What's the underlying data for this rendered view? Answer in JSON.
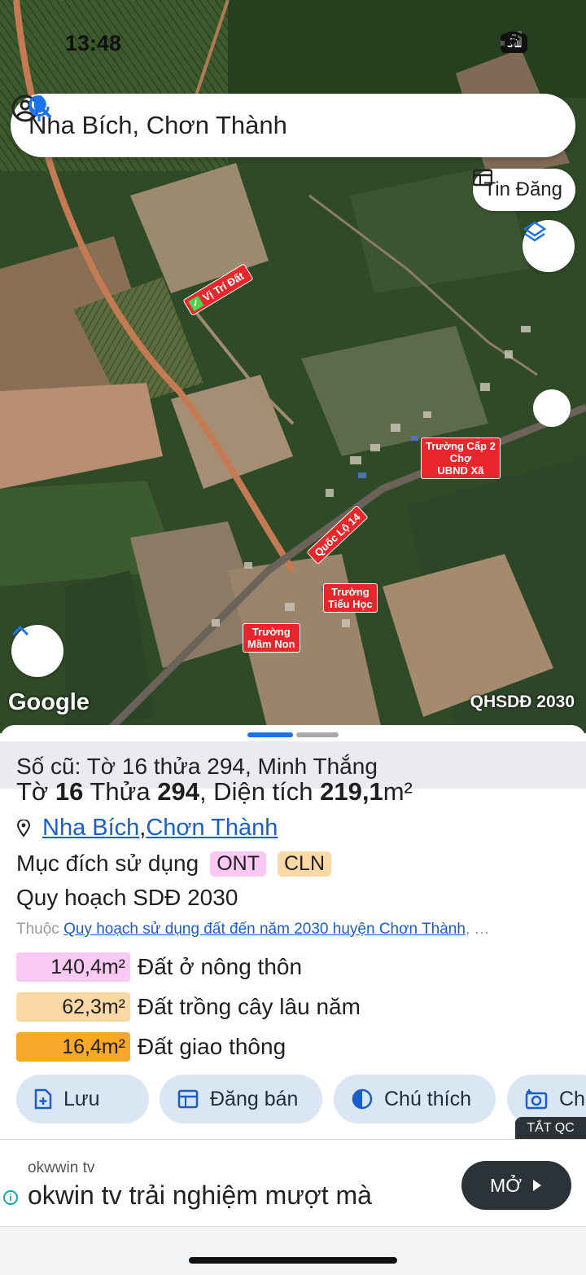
{
  "status": {
    "time": "13:48",
    "battery": "91"
  },
  "search": {
    "query": "Nha Bích, Chơn Thành"
  },
  "map": {
    "listing_button": "Tin Đăng",
    "google_logo": "Google",
    "plan_label": "QHSDĐ 2030",
    "labels": {
      "vi_tri": "Vị Trí Đất",
      "road": "Quốc Lộ 14",
      "truong_cap2_line1": "Trường Cấp 2",
      "truong_cap2_line2": "Chợ",
      "truong_cap2_line3": "UBND Xã",
      "tieu_hoc_line1": "Trường",
      "tieu_hoc_line2": "Tiểu Học",
      "mam_non_line1": "Trường",
      "mam_non_line2": "Mầm Non"
    }
  },
  "parcel": {
    "old_info": "Số cũ: Tờ 16 thửa 294, Minh Thắng",
    "to_label": "Tờ ",
    "to_value": "16",
    "thua_label": " Thửa ",
    "thua_value": "294",
    "area_label": ", Diện tích ",
    "area_value": "219,1",
    "area_unit": "m²",
    "location_1": "Nha Bích",
    "location_sep": ", ",
    "location_2": "Chơn Thành",
    "purpose_label": "Mục đích sử dụng",
    "purpose_tags": [
      "ONT",
      "CLN"
    ],
    "plan_title": "Quy hoạch SDĐ 2030",
    "belongs_prefix": "Thuộc ",
    "belongs_link": "Quy hoạch sử dụng đất đến năm 2030 huyện Chơn Thành",
    "belongs_suffix": ", …",
    "areas": [
      {
        "value": "140,4m²",
        "label": "Đất ở nông thôn",
        "color": "#f9c9f3"
      },
      {
        "value": "62,3m²",
        "label": "Đất trồng cây lâu năm",
        "color": "#fcd9a4"
      },
      {
        "value": "16,4m²",
        "label": "Đất giao thông",
        "color": "#f9a829"
      }
    ]
  },
  "actions": {
    "save": "Lưu",
    "sell": "Đăng bán",
    "legend": "Chú thích",
    "capture": "Ch"
  },
  "ad": {
    "hide_label": "TẮT QC",
    "advertiser": "okwwin tv",
    "headline": "okwin tv trải nghiệm mượt mà",
    "open_button": "MỞ"
  },
  "colors": {
    "accent_blue": "#1a73e8",
    "marker_red": "#e8272d",
    "chip_bg": "#dbe6f4"
  }
}
